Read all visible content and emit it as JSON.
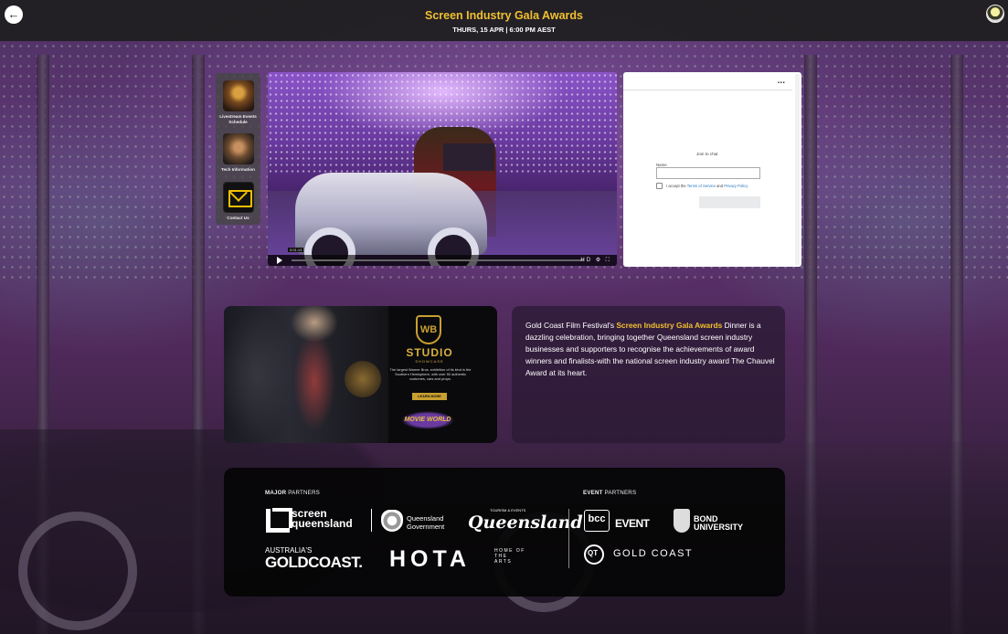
{
  "header": {
    "back_icon": "arrow-left-icon",
    "title": "Screen Industry Gala Awards",
    "date": "THURS, 15 APR | 6:00 PM AEST",
    "avatar_icon": "user-avatar-icon",
    "title_color": "#f0c030"
  },
  "sidenav": {
    "items": [
      {
        "label": "Livestream Events Schedule"
      },
      {
        "label": "Tech Information"
      },
      {
        "label": "Contact Us"
      }
    ]
  },
  "video": {
    "time_tooltip": "0:01:13",
    "control_icons": "HD ⚙ ⛶"
  },
  "chat": {
    "menu_icon": "...",
    "join_title": "Join to chat",
    "name_label": "Name",
    "accept_prefix": "I accept the ",
    "terms_link": "Terms of Service",
    "and_text": " and ",
    "privacy_link": "Privacy Policy",
    "join_button": "Join"
  },
  "promo": {
    "brand": "WB",
    "studio": "STUDIO",
    "showcase": "SHOWCASE",
    "description": "The largest Warner Bros. exhibition of its kind in the Southern Hemisphere, with over 50 authentic costumes, cars and props.",
    "cta": "LEARN MORE",
    "park_logo": "MOVIE WORLD"
  },
  "description": {
    "part1": "Gold Coast Film Festival's ",
    "highlight": "Screen Industry Gala Awards",
    "part2": " Dinner is a dazzling celebration, bringing together Queensland screen industry businesses and supporters to recognise the achievements of award winners and finalists-with the national screen industry award The Chauvel Award at its heart."
  },
  "partners": {
    "major_bold": "MAJOR",
    "major_rest": " PARTNERS",
    "event_bold": "EVENT",
    "event_rest": " PARTNERS",
    "screen_queensland": "screen\nqueensland",
    "qld_gov_1": "Queensland",
    "qld_gov_2": "Government",
    "tourism": "TOURISM & EVENTS",
    "queensland_script": "Queensland",
    "australias": "AUSTRALIA'S",
    "goldcoast": "GOLDCOAST.",
    "hota": "HOTA",
    "hota_sub": "HOME OF THE ARTS",
    "bcc": "bcc",
    "event": "EVENT",
    "bond_1": "BOND",
    "bond_2": "UNIVERSITY",
    "qt": "QT",
    "qt_name": "GOLD COAST"
  }
}
